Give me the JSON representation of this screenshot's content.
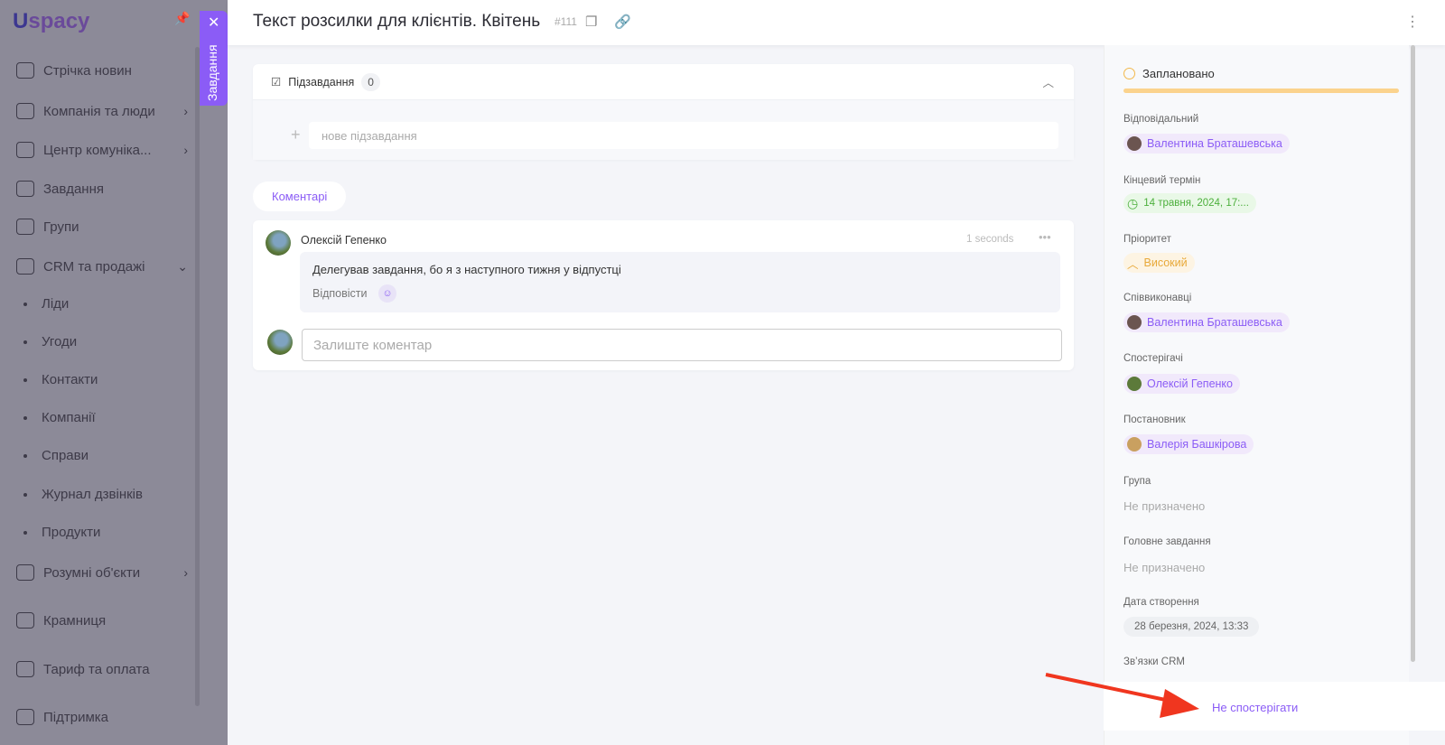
{
  "sidebar": {
    "logo": "Uspacy",
    "items": [
      {
        "label": "Стрічка новин",
        "icon": "home-icon",
        "y": 79
      },
      {
        "label": "Компанія та люди",
        "icon": "building-icon",
        "chev": true
      },
      {
        "label": "Центр комуніка...",
        "icon": "chat-icon",
        "chev": true
      },
      {
        "label": "Завдання",
        "icon": "calendar-icon"
      },
      {
        "label": "Групи",
        "icon": "users-icon"
      },
      {
        "label": "CRM та продажі",
        "icon": "crm-icon",
        "chev": true
      },
      {
        "label": "Ліди",
        "sub": true
      },
      {
        "label": "Угоди",
        "sub": true
      },
      {
        "label": "Контакти",
        "sub": true
      },
      {
        "label": "Компанії",
        "sub": true
      },
      {
        "label": "Справи",
        "sub": true
      },
      {
        "label": "Журнал дзвінків",
        "sub": true
      },
      {
        "label": "Продукти",
        "sub": true
      },
      {
        "label": "Розумні об'єкти",
        "icon": "cube-icon",
        "chev": true
      },
      {
        "label": "Крамниця",
        "icon": "store-icon"
      },
      {
        "label": "Тариф та оплата",
        "icon": "wallet-icon"
      },
      {
        "label": "Підтримка",
        "icon": "help-icon"
      }
    ]
  },
  "task_tab": {
    "label": "Завдання"
  },
  "header": {
    "title": "Текст розсилки для клієнтів. Квітень",
    "number": "#111"
  },
  "subtasks": {
    "label": "Підзавдання",
    "count": "0",
    "placeholder": "нове підзавдання"
  },
  "comments": {
    "tab": "Коментарі",
    "author": "Олексій Гепенко",
    "time": "1 seconds",
    "text": "Делегував завдання, бо я з наступного тижня у відпустці",
    "reply": "Відповісти",
    "placeholder": "Залиште коментар"
  },
  "details": {
    "status": "Заплановано",
    "status_color": "#fbd38d",
    "responsible_label": "Відповідальний",
    "responsible": "Валентина Браташевська",
    "deadline_label": "Кінцевий термін",
    "deadline": "14 травня, 2024, 17:...",
    "priority_label": "Пріоритет",
    "priority": "Високий",
    "coexecutors_label": "Співвиконавці",
    "coexecutor": "Валентина Браташевська",
    "observers_label": "Спостерігачі",
    "observer": "Олексій Гепенко",
    "creator_label": "Постановник",
    "creator": "Валерія Башкірова",
    "group_label": "Група",
    "group": "Не призначено",
    "parent_label": "Головне завдання",
    "parent": "Не призначено",
    "created_label": "Дата створення",
    "created": "28 березня, 2024, 13:33",
    "crm_label": "Зв’язки CRM"
  },
  "footer": {
    "unwatch": "Не спостерігати"
  }
}
